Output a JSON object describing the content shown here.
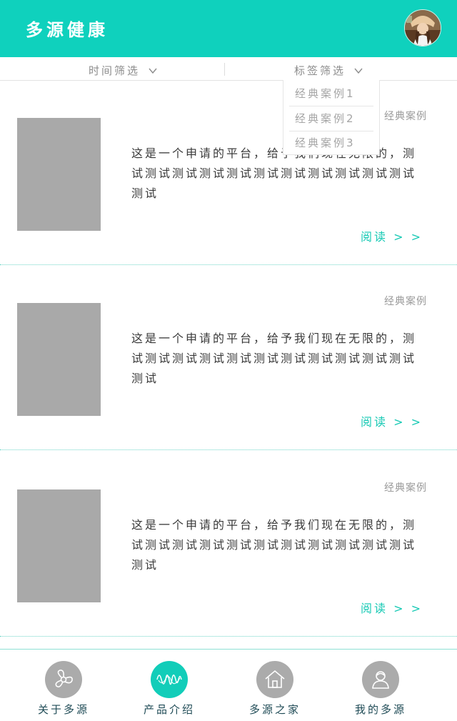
{
  "header": {
    "title": "多源健康"
  },
  "filters": [
    {
      "label": "时间筛选",
      "icon": "chevron-down-icon"
    },
    {
      "label": "标签筛选",
      "icon": "chevron-down-icon"
    }
  ],
  "tag_dropdown": {
    "options": [
      "经典案例1",
      "经典案例2",
      "经典案例3"
    ]
  },
  "cards": [
    {
      "tag": "经典案例",
      "text": "这是一个申请的平台，给予我们现在无限的，测试测试测试测试测试测试测试测试测试测试测试测试",
      "read": "阅读 > >"
    },
    {
      "tag": "经典案例",
      "text": "这是一个申请的平台，给予我们现在无限的，测试测试测试测试测试测试测试测试测试测试测试测试",
      "read": "阅读 > >"
    },
    {
      "tag": "经典案例",
      "text": "这是一个申请的平台，给予我们现在无限的，测试测试测试测试测试测试测试测试测试测试测试测试",
      "read": "阅读 > >"
    }
  ],
  "tabbar": {
    "items": [
      {
        "label": "关于多源",
        "icon": "spinner-icon",
        "active": false
      },
      {
        "label": "产品介绍",
        "icon": "wave-icon",
        "active": true
      },
      {
        "label": "多源之家",
        "icon": "home-icon",
        "active": false
      },
      {
        "label": "我的多源",
        "icon": "user-icon",
        "active": false
      }
    ]
  },
  "colors": {
    "brand": "#0fd1bd",
    "accent": "#16c9b4",
    "inactive_icon": "#ababab"
  }
}
